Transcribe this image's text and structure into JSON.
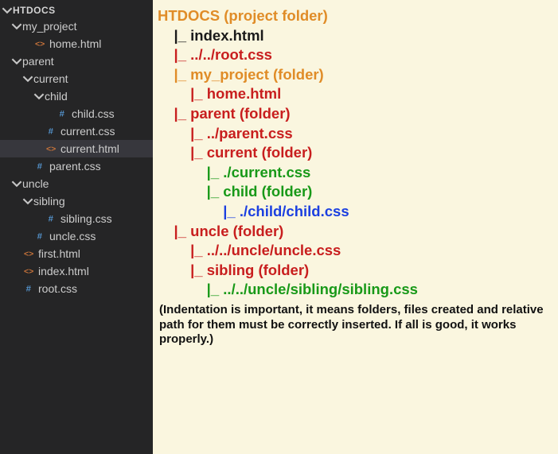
{
  "sidebar": {
    "root_label": "HTDOCS",
    "items": [
      {
        "label": "my_project",
        "type": "folder",
        "indent": 1,
        "open": true,
        "selected": false
      },
      {
        "label": "home.html",
        "type": "html",
        "indent": 2,
        "selected": false
      },
      {
        "label": "parent",
        "type": "folder",
        "indent": 1,
        "open": true,
        "selected": false
      },
      {
        "label": "current",
        "type": "folder",
        "indent": 2,
        "open": true,
        "selected": false
      },
      {
        "label": "child",
        "type": "folder",
        "indent": 3,
        "open": true,
        "selected": false
      },
      {
        "label": "child.css",
        "type": "css",
        "indent": 4,
        "selected": false
      },
      {
        "label": "current.css",
        "type": "css",
        "indent": 3,
        "selected": false
      },
      {
        "label": "current.html",
        "type": "html",
        "indent": 3,
        "selected": true
      },
      {
        "label": "parent.css",
        "type": "css",
        "indent": 2,
        "selected": false
      },
      {
        "label": "uncle",
        "type": "folder",
        "indent": 1,
        "open": true,
        "selected": false
      },
      {
        "label": "sibling",
        "type": "folder",
        "indent": 2,
        "open": true,
        "selected": false
      },
      {
        "label": "sibling.css",
        "type": "css",
        "indent": 3,
        "selected": false
      },
      {
        "label": "uncle.css",
        "type": "css",
        "indent": 2,
        "selected": false
      },
      {
        "label": "first.html",
        "type": "html",
        "indent": 1,
        "selected": false
      },
      {
        "label": "index.html",
        "type": "html",
        "indent": 1,
        "selected": false
      },
      {
        "label": "root.css",
        "type": "css",
        "indent": 1,
        "selected": false
      }
    ]
  },
  "diagram": {
    "lines": [
      {
        "text": "HTDOCS (project folder)",
        "color": "orange",
        "indent": 0
      },
      {
        "text": "|_ index.html",
        "color": "black",
        "indent": 1
      },
      {
        "text": "|_ ../../root.css",
        "color": "red",
        "indent": 1
      },
      {
        "text": "|_ my_project (folder)",
        "color": "orange",
        "indent": 1
      },
      {
        "text": "|_ home.html",
        "color": "red",
        "indent": 2
      },
      {
        "text": "|_ parent (folder)",
        "color": "red",
        "indent": 1
      },
      {
        "text": "|_ ../parent.css",
        "color": "red",
        "indent": 2
      },
      {
        "text": "|_ current (folder)",
        "color": "red",
        "indent": 2
      },
      {
        "text": "|_ ./current.css",
        "color": "green",
        "indent": 3
      },
      {
        "text": "|_ child (folder)",
        "color": "green",
        "indent": 3
      },
      {
        "text": "|_ ./child/child.css",
        "color": "blue",
        "indent": 4
      },
      {
        "text": "|_ uncle (folder)",
        "color": "red",
        "indent": 1
      },
      {
        "text": "|_ ../../uncle/uncle.css",
        "color": "red",
        "indent": 2
      },
      {
        "text": "|_ sibling (folder)",
        "color": "red",
        "indent": 2
      },
      {
        "text": "|_ ../../uncle/sibling/sibling.css",
        "color": "green",
        "indent": 3
      }
    ],
    "note": "(Indentation is important, it means folders, files created and relative path for them must be correctly inserted. If all is good, it works properly.)"
  }
}
